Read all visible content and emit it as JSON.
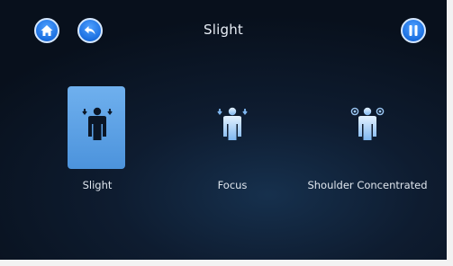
{
  "header": {
    "title": "Slight",
    "home_icon": "home-icon",
    "back_icon": "back-arrow-icon",
    "pause_icon": "pause-icon"
  },
  "modes": [
    {
      "label": "Slight",
      "icon": "person-slight-icon",
      "selected": true
    },
    {
      "label": "Focus",
      "icon": "person-focus-icon",
      "selected": false
    },
    {
      "label": "Shoulder Concentrated",
      "icon": "person-shoulder-icon",
      "selected": false
    }
  ],
  "colors": {
    "accent": "#1b6fe0",
    "selected_tile": "#5a9fe4",
    "icon_light": "#cfe6ff",
    "background": "#0e1c30"
  }
}
